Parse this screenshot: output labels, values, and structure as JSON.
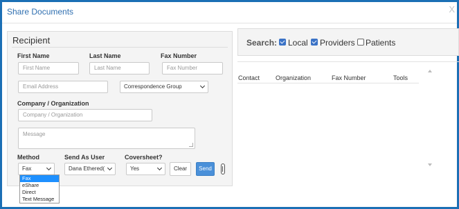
{
  "dialog": {
    "title": "Share Documents",
    "close": "X"
  },
  "recipient": {
    "title": "Recipient",
    "first_name_label": "First Name",
    "last_name_label": "Last Name",
    "fax_number_label": "Fax Number",
    "first_name_placeholder": "First Name",
    "last_name_placeholder": "Last Name",
    "fax_number_placeholder": "Fax Number",
    "email_placeholder": "Email Address",
    "correspondence_group": "Correspondence Group",
    "company_label": "Company / Organization",
    "company_placeholder": "Company / Organization",
    "message_placeholder": "Message",
    "method_label": "Method",
    "send_as_label": "Send As User",
    "coversheet_label": "Coversheet?",
    "method_value": "Fax",
    "send_as_value": "Dana Ethered(",
    "coversheet_value": "Yes",
    "clear_label": "Clear",
    "send_label": "Send",
    "method_options": [
      "Fax",
      "eShare",
      "Direct",
      "Text Message"
    ]
  },
  "search": {
    "label": "Search:",
    "local": "Local",
    "providers": "Providers",
    "patients": "Patients",
    "local_checked": true,
    "providers_checked": true,
    "patients_checked": false
  },
  "results": {
    "columns": [
      "Contact",
      "Organization",
      "Fax Number",
      "Tools"
    ]
  },
  "colors": {
    "frame": "#1b6fb5",
    "accent": "#4a90d9",
    "checkbox": "#3b73c6"
  }
}
